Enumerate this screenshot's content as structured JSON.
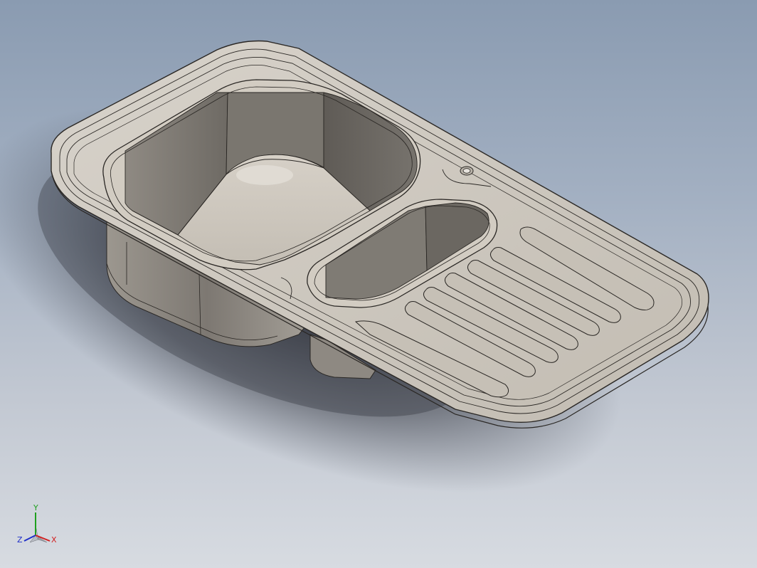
{
  "viewport": {
    "background_top": "#8a9bb1",
    "background_bottom": "#d7dbe1"
  },
  "model": {
    "part": "kitchen-sink",
    "material_color": "#c9c3b9",
    "edge_color": "#2a2724",
    "shadow_color": "#3a3d45"
  },
  "triad": {
    "x_label": "X",
    "y_label": "Y",
    "z_label": "Z",
    "x_color": "#d22020",
    "y_color": "#1fa01f",
    "z_color": "#2030c8"
  }
}
